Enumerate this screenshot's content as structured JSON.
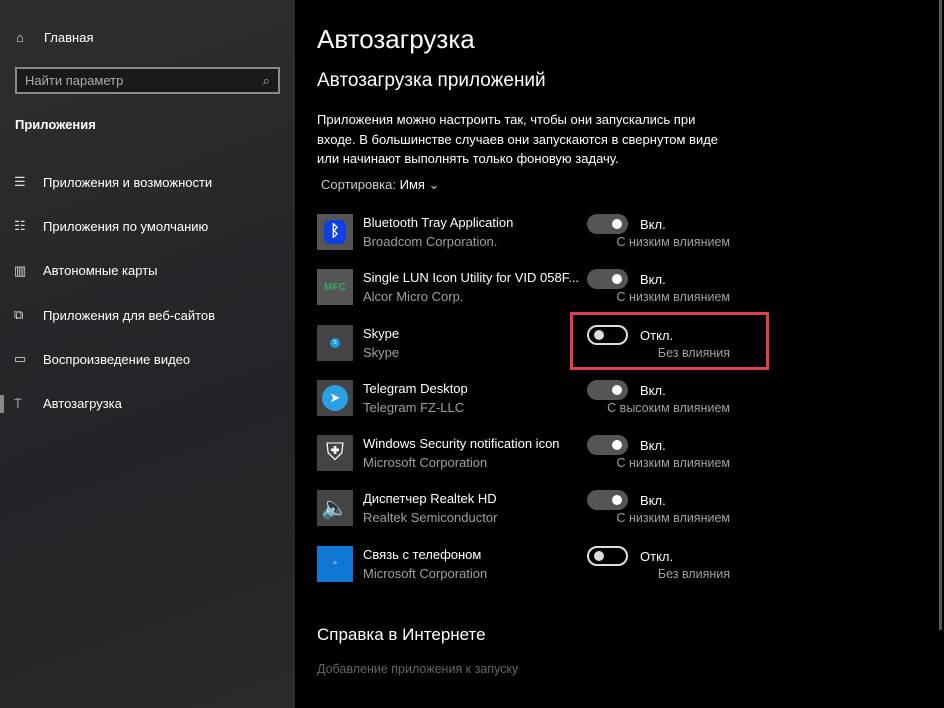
{
  "sidebar": {
    "home": "Главная",
    "search_placeholder": "Найти параметр",
    "section": "Приложения",
    "items": [
      {
        "label": "Приложения и возможности"
      },
      {
        "label": "Приложения по умолчанию"
      },
      {
        "label": "Автономные карты"
      },
      {
        "label": "Приложения для веб-сайтов"
      },
      {
        "label": "Воспроизведение видео"
      },
      {
        "label": "Автозагрузка"
      }
    ]
  },
  "main": {
    "title": "Автозагрузка",
    "subtitle": "Автозагрузка приложений",
    "description": "Приложения можно настроить так, чтобы они запускались при входе. В большинстве случаев они запускаются в свернутом виде или начинают выполнять только фоновую задачу.",
    "sort_label": "Сортировка:",
    "sort_value": "Имя",
    "apps": [
      {
        "name": "Bluetooth Tray Application",
        "publisher": "Broadcom Corporation.",
        "on": true,
        "state": "Вкл.",
        "impact": "С низким влиянием"
      },
      {
        "name": "Single LUN Icon Utility for VID 058F...",
        "publisher": "Alcor Micro Corp.",
        "on": true,
        "state": "Вкл.",
        "impact": "С низким влиянием"
      },
      {
        "name": "Skype",
        "publisher": "Skype",
        "on": false,
        "state": "Откл.",
        "impact": "Без влияния"
      },
      {
        "name": "Telegram Desktop",
        "publisher": "Telegram FZ-LLC",
        "on": true,
        "state": "Вкл.",
        "impact": "С высоким влиянием"
      },
      {
        "name": "Windows Security notification icon",
        "publisher": "Microsoft Corporation",
        "on": true,
        "state": "Вкл.",
        "impact": "С низким влиянием"
      },
      {
        "name": "Диспетчер Realtek HD",
        "publisher": "Realtek Semiconductor",
        "on": true,
        "state": "Вкл.",
        "impact": "С низким влиянием"
      },
      {
        "name": "Связь с телефоном",
        "publisher": "Microsoft Corporation",
        "on": false,
        "state": "Откл.",
        "impact": "Без влияния"
      }
    ],
    "help_title": "Справка в Интернете",
    "help_link": "Добавление приложения к запуску"
  },
  "colors": {
    "highlight": "#e0404a"
  }
}
